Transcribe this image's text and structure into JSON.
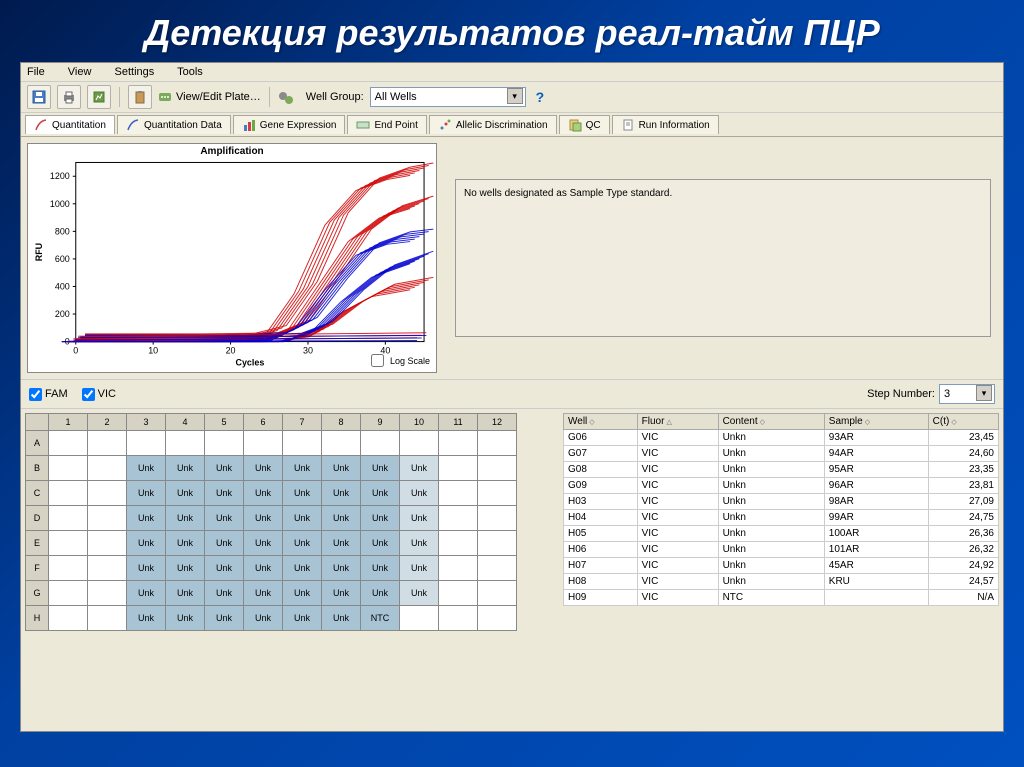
{
  "page_title": "Детекция результатов  реал-тайм ПЦР",
  "menu": {
    "file": "File",
    "view": "View",
    "settings": "Settings",
    "tools": "Tools"
  },
  "toolbar": {
    "save_icon": "save",
    "print_icon": "print",
    "report_icon": "report",
    "clipboard_icon": "clipboard",
    "plate_icon": "plate",
    "view_edit_plate": "View/Edit Plate…",
    "wells_icon": "wells",
    "well_group_label": "Well Group:",
    "well_group_value": "All Wells",
    "help": "?"
  },
  "tabs": [
    {
      "label": "Quantitation",
      "active": true
    },
    {
      "label": "Quantitation Data"
    },
    {
      "label": "Gene Expression"
    },
    {
      "label": "End Point"
    },
    {
      "label": "Allelic Discrimination"
    },
    {
      "label": "QC"
    },
    {
      "label": "Run Information"
    }
  ],
  "chart": {
    "title": "Amplification",
    "xlabel": "Cycles",
    "ylabel": "RFU",
    "log_scale_label": "Log Scale"
  },
  "chart_data": {
    "type": "line",
    "title": "Amplification",
    "xlabel": "Cycles",
    "ylabel": "RFU",
    "xlim": [
      0,
      45
    ],
    "ylim": [
      0,
      1300
    ],
    "x_ticks": [
      0,
      10,
      20,
      30,
      40
    ],
    "y_ticks": [
      0,
      200,
      400,
      600,
      800,
      1000,
      1200
    ],
    "series": [
      {
        "name": "red-high",
        "color": "#d00000",
        "x": [
          0,
          15,
          22,
          26,
          30,
          34,
          38,
          42,
          45
        ],
        "values": [
          20,
          20,
          25,
          80,
          400,
          900,
          1150,
          1230,
          1260
        ]
      },
      {
        "name": "red-mid",
        "color": "#d00000",
        "x": [
          0,
          18,
          25,
          29,
          33,
          37,
          41,
          45
        ],
        "values": [
          15,
          15,
          30,
          120,
          450,
          780,
          950,
          1020
        ]
      },
      {
        "name": "red-low",
        "color": "#d00000",
        "x": [
          0,
          22,
          28,
          32,
          36,
          40,
          44,
          45
        ],
        "values": [
          10,
          10,
          25,
          90,
          260,
          380,
          420,
          430
        ]
      },
      {
        "name": "blue-high",
        "color": "#0000d0",
        "x": [
          0,
          20,
          26,
          30,
          34,
          38,
          42,
          45
        ],
        "values": [
          10,
          10,
          30,
          140,
          430,
          680,
          760,
          780
        ]
      },
      {
        "name": "blue-mid",
        "color": "#0000d0",
        "x": [
          0,
          22,
          28,
          32,
          36,
          40,
          44,
          45
        ],
        "values": [
          10,
          10,
          25,
          110,
          340,
          520,
          600,
          620
        ]
      },
      {
        "name": "flat-red",
        "color": "#d00000",
        "x": [
          0,
          45
        ],
        "values": [
          30,
          55
        ]
      },
      {
        "name": "flat-blue",
        "color": "#0000d0",
        "x": [
          0,
          45
        ],
        "values": [
          20,
          35
        ]
      }
    ]
  },
  "message": "No wells designated as Sample Type standard.",
  "fluor": {
    "fam": "FAM",
    "vic": "VIC"
  },
  "step_number": {
    "label": "Step Number:",
    "value": "3"
  },
  "plate": {
    "cols": [
      "1",
      "2",
      "3",
      "4",
      "5",
      "6",
      "7",
      "8",
      "9",
      "10",
      "11",
      "12"
    ],
    "rows": [
      "A",
      "B",
      "C",
      "D",
      "E",
      "F",
      "G",
      "H"
    ],
    "unk": "Unk",
    "ntc": "NTC"
  },
  "table": {
    "headers": {
      "well": "Well",
      "fluor": "Fluor",
      "content": "Content",
      "sample": "Sample",
      "cq": "C(t)"
    },
    "rows": [
      {
        "well": "G06",
        "fluor": "VIC",
        "content": "Unkn",
        "sample": "93AR",
        "cq": "23,45"
      },
      {
        "well": "G07",
        "fluor": "VIC",
        "content": "Unkn",
        "sample": "94AR",
        "cq": "24,60"
      },
      {
        "well": "G08",
        "fluor": "VIC",
        "content": "Unkn",
        "sample": "95AR",
        "cq": "23,35"
      },
      {
        "well": "G09",
        "fluor": "VIC",
        "content": "Unkn",
        "sample": "96AR",
        "cq": "23,81"
      },
      {
        "well": "H03",
        "fluor": "VIC",
        "content": "Unkn",
        "sample": "98AR",
        "cq": "27,09"
      },
      {
        "well": "H04",
        "fluor": "VIC",
        "content": "Unkn",
        "sample": "99AR",
        "cq": "24,75"
      },
      {
        "well": "H05",
        "fluor": "VIC",
        "content": "Unkn",
        "sample": "100AR",
        "cq": "26,36"
      },
      {
        "well": "H06",
        "fluor": "VIC",
        "content": "Unkn",
        "sample": "101AR",
        "cq": "26,32"
      },
      {
        "well": "H07",
        "fluor": "VIC",
        "content": "Unkn",
        "sample": "45AR",
        "cq": "24,92"
      },
      {
        "well": "H08",
        "fluor": "VIC",
        "content": "Unkn",
        "sample": "KRU",
        "cq": "24,57"
      },
      {
        "well": "H09",
        "fluor": "VIC",
        "content": "NTC",
        "sample": "",
        "cq": "N/A"
      }
    ]
  }
}
